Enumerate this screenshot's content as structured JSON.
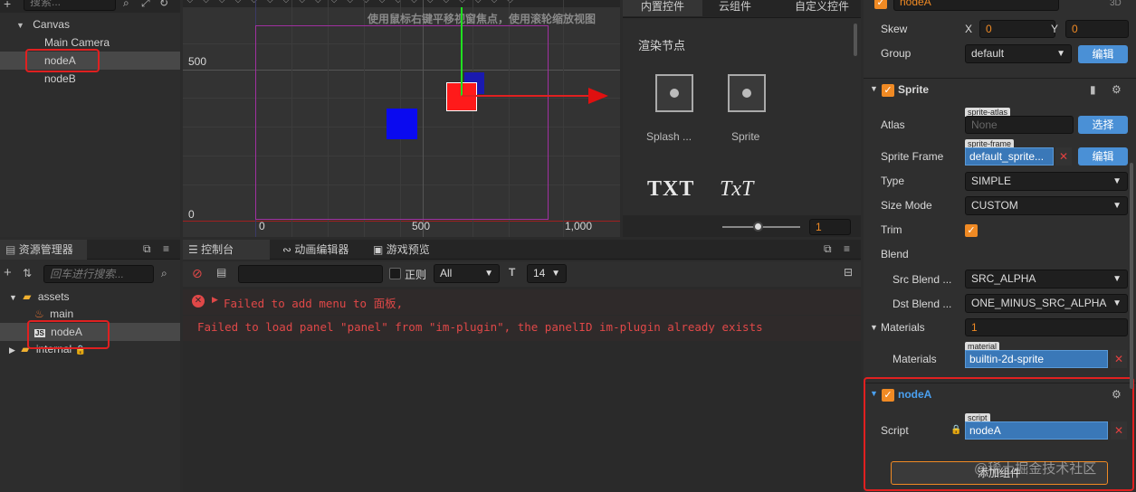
{
  "hierarchy": {
    "search_placeholder": "搜索...",
    "nodes": [
      {
        "label": "Canvas"
      },
      {
        "label": "Main Camera"
      },
      {
        "label": "nodeA"
      },
      {
        "label": "nodeB"
      }
    ]
  },
  "scene": {
    "hint": "使用鼠标右键平移视窗焦点，使用滚轮缩放视图",
    "axis_labels": {
      "y500": "500",
      "y0": "0",
      "x0": "0",
      "x500": "500",
      "x1000": "1,000"
    }
  },
  "widgets": {
    "tabs": [
      "内置控件",
      "云组件",
      "自定义控件"
    ],
    "section_title": "渲染节点",
    "items": [
      {
        "label": "Splash ..."
      },
      {
        "label": "Sprite"
      }
    ],
    "txt1": "TXT",
    "txt2": "TxT",
    "zoom_value": "1"
  },
  "assets": {
    "title": "资源管理器",
    "search_placeholder": "回车进行搜索...",
    "items": [
      {
        "label": "assets"
      },
      {
        "label": "main"
      },
      {
        "label": "nodeA"
      },
      {
        "label": "internal"
      }
    ]
  },
  "console": {
    "tabs": [
      "控制台",
      "动画编辑器",
      "游戏预览"
    ],
    "regex_label": "正则",
    "level_select": "All",
    "font_size": "14",
    "lines": [
      "Failed to add menu to 面板,",
      "Failed to load panel \"panel\" from \"im-plugin\", the panelID im-plugin already exists"
    ]
  },
  "inspector": {
    "node_name": "nodeA",
    "badge_3d": "3D",
    "skew_label": "Skew",
    "skew_x_label": "X",
    "skew_x": "0",
    "skew_y_label": "Y",
    "skew_y": "0",
    "group_label": "Group",
    "group_value": "default",
    "edit_label": "编辑",
    "sprite_title": "Sprite",
    "atlas_label": "Atlas",
    "atlas_tag": "sprite-atlas",
    "atlas_value": "None",
    "select_label": "选择",
    "frame_label": "Sprite Frame",
    "frame_tag": "sprite-frame",
    "frame_value": "default_sprite...",
    "type_label": "Type",
    "type_value": "SIMPLE",
    "size_mode_label": "Size Mode",
    "size_mode_value": "CUSTOM",
    "trim_label": "Trim",
    "blend_label": "Blend",
    "src_blend_label": "Src Blend ...",
    "src_blend_value": "SRC_ALPHA",
    "dst_blend_label": "Dst Blend ...",
    "dst_blend_value": "ONE_MINUS_SRC_ALPHA",
    "materials_label": "Materials",
    "materials_count": "1",
    "material_tag": "material",
    "material_value": "builtin-2d-sprite",
    "script_comp_title": "nodeA",
    "script_label": "Script",
    "script_tag": "script",
    "script_value": "nodeA",
    "add_component": "添加组件"
  },
  "watermark": "@稀土掘金技术社区",
  "colors": {
    "accent": "#4a90d6",
    "check": "#f08a24",
    "error": "#e04848",
    "highlight": "#e02020"
  }
}
